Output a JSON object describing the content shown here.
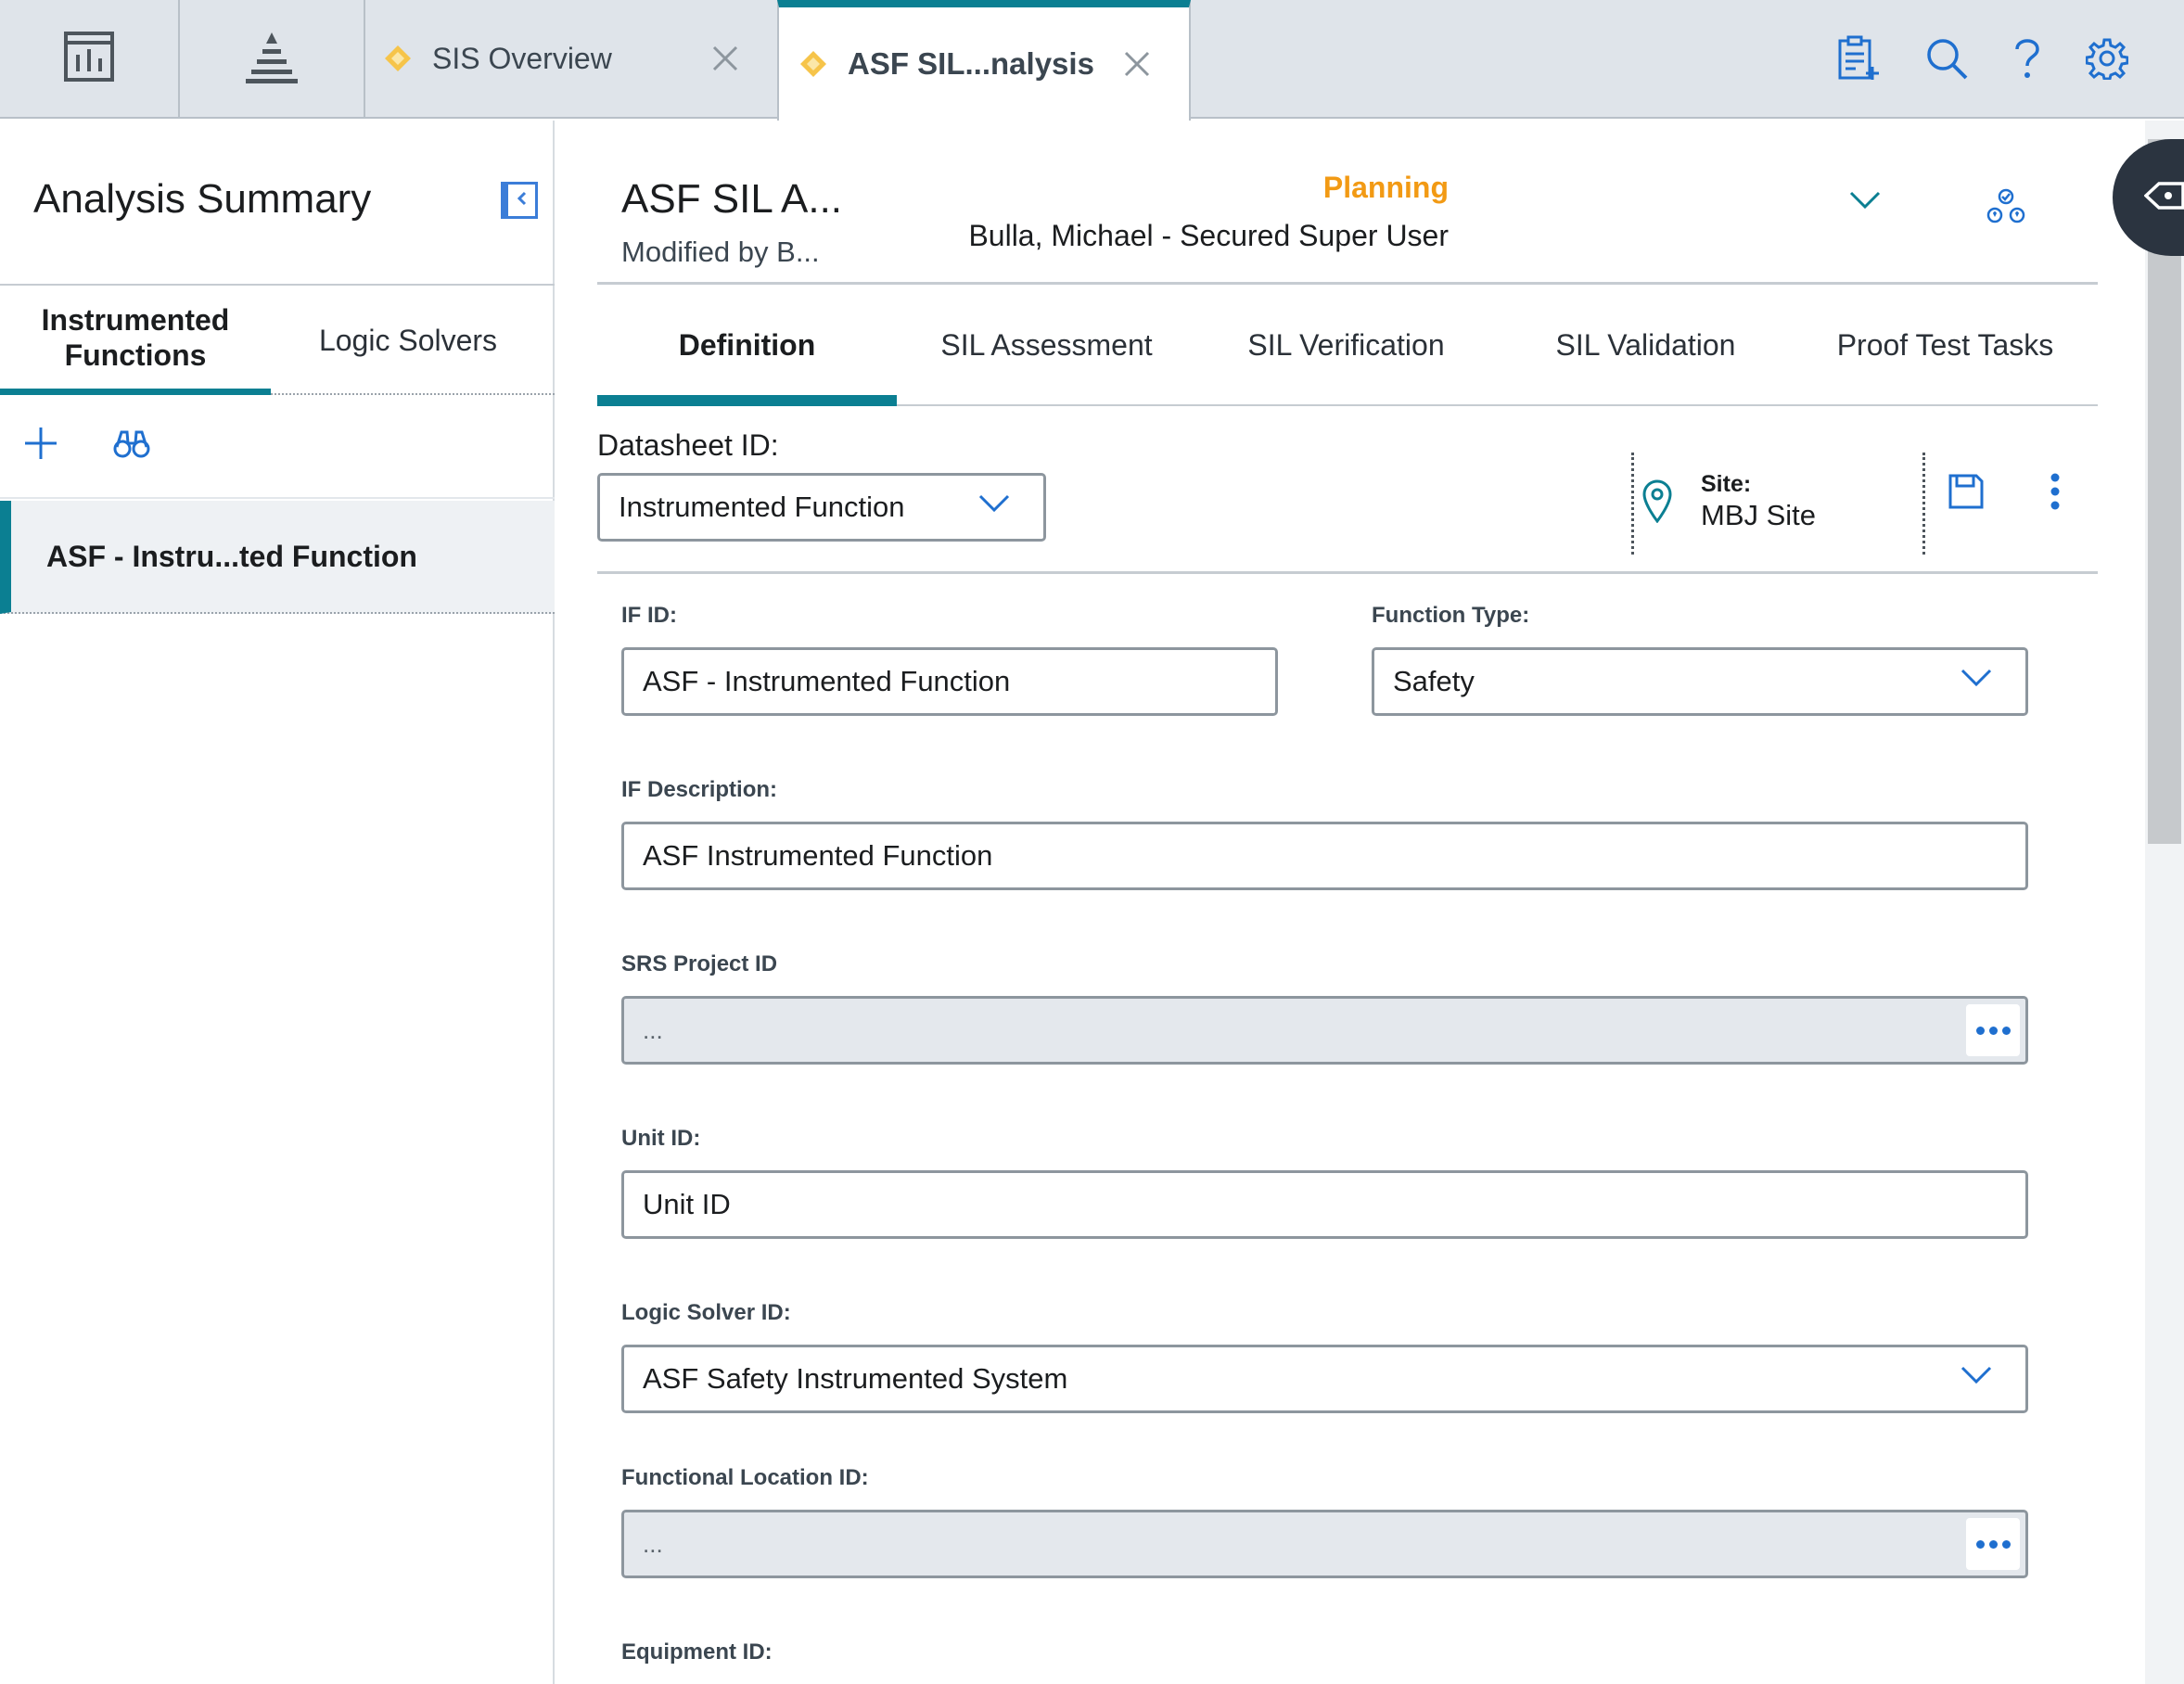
{
  "topbar": {
    "icons": [
      "dashboard-icon",
      "hierarchy-icon"
    ],
    "tabs": [
      {
        "label": "SIS Overview",
        "active": false
      },
      {
        "label": "ASF SIL...nalysis",
        "active": true
      }
    ],
    "actions": [
      "new-record-icon",
      "search-icon",
      "help-icon",
      "settings-icon"
    ]
  },
  "left": {
    "title": "Analysis Summary",
    "tabs": [
      {
        "label": "Instrumented Functions",
        "active": true
      },
      {
        "label": "Logic Solvers",
        "active": false
      }
    ],
    "tools": [
      "add-icon",
      "binoculars-icon"
    ],
    "items": [
      {
        "label": "ASF - Instru...ted Function",
        "selected": true
      }
    ]
  },
  "record": {
    "title": "ASF SIL A...",
    "modified": "Modified by B...",
    "state": "Planning",
    "state_user": "Bulla, Michael - Secured Super User"
  },
  "main_tabs": [
    {
      "label": "Definition",
      "active": true
    },
    {
      "label": "SIL Assessment",
      "active": false
    },
    {
      "label": "SIL Verification",
      "active": false
    },
    {
      "label": "SIL Validation",
      "active": false
    },
    {
      "label": "Proof Test Tasks",
      "active": false
    }
  ],
  "datasheet": {
    "label": "Datasheet ID:",
    "value": "Instrumented Function",
    "site_label": "Site:",
    "site_value": "MBJ Site"
  },
  "form": {
    "if_id": {
      "label": "IF ID:",
      "value": "ASF - Instrumented Function"
    },
    "function_type": {
      "label": "Function Type:",
      "value": "Safety"
    },
    "if_description": {
      "label": "IF Description:",
      "value": "ASF Instrumented Function"
    },
    "srs_project_id": {
      "label": "SRS Project ID",
      "value": "..."
    },
    "unit_id": {
      "label": "Unit ID:",
      "value": "Unit ID"
    },
    "logic_solver_id": {
      "label": "Logic Solver ID:",
      "value": "ASF Safety Instrumented System"
    },
    "functional_location_id": {
      "label": "Functional Location ID:",
      "value": "..."
    },
    "equipment_id": {
      "label": "Equipment ID:"
    }
  },
  "colors": {
    "accent": "#0b7f92",
    "state": "#f29a14",
    "icon_blue": "#1f6fcf"
  }
}
